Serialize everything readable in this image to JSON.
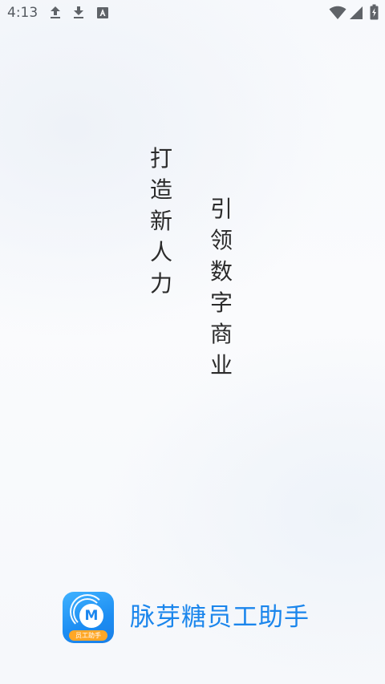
{
  "status_bar": {
    "time": "4:13",
    "icons": [
      "upload-icon",
      "download-icon",
      "keyboard-icon",
      "wifi-icon",
      "signal-icon",
      "battery-icon"
    ]
  },
  "slogans": {
    "line1": [
      "打",
      "造",
      "新",
      "人",
      "力"
    ],
    "line2": [
      "引",
      "领",
      "数",
      "字",
      "商",
      "业"
    ]
  },
  "brand": {
    "logo_letter": "M",
    "logo_banner": "员工助手",
    "app_name": "脉芽糖员工助手",
    "accent_color": "#1b86ec"
  }
}
